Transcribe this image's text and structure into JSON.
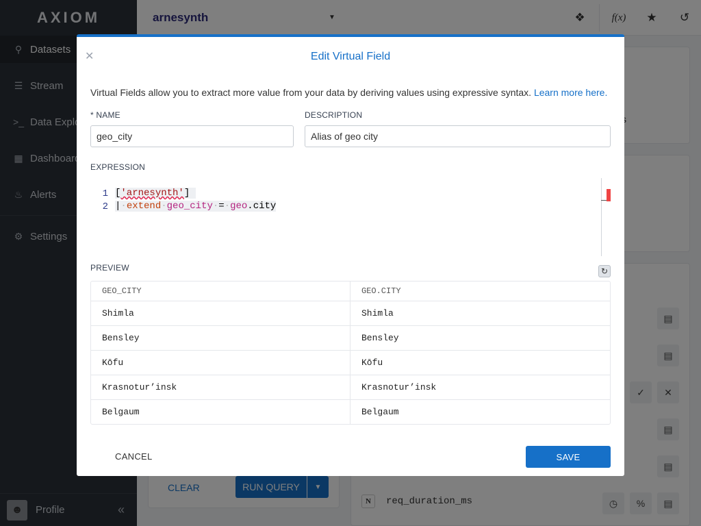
{
  "app": {
    "logo": "AXIOM"
  },
  "sidebar": {
    "items": [
      {
        "label": "Datasets",
        "icon": "search-icon"
      },
      {
        "label": "Stream",
        "icon": "stream-icon"
      },
      {
        "label": "Data Explorer",
        "icon": "terminal-icon"
      },
      {
        "label": "Dashboards",
        "icon": "dashboard-icon"
      },
      {
        "label": "Alerts",
        "icon": "bell-icon"
      },
      {
        "label": "Settings",
        "icon": "gear-icon"
      }
    ],
    "profile_label": "Profile"
  },
  "topbar": {
    "dataset": "arnesynth"
  },
  "background": {
    "clear_label": "CLEAR",
    "run_label": "RUN QUERY",
    "field_type": "N",
    "field_name": "req_duration_ms",
    "partial_text": "s"
  },
  "modal": {
    "title": "Edit Virtual Field",
    "description": "Virtual Fields allow you to extract more value from your data by deriving values using expressive syntax.",
    "learn_more": "Learn more here.",
    "name_label": "* NAME",
    "name_value": "geo_city",
    "description_label": "DESCRIPTION",
    "description_value": "Alias of geo city",
    "expression_label": "EXPRESSION",
    "code": {
      "line1_num": "1",
      "line2_num": "2",
      "line1_open": "[",
      "line1_str": "'arnesynth'",
      "line1_close": "]",
      "line2_pipe": "|",
      "line2_kw": "extend",
      "line2_field": "geo_city",
      "line2_eq": "=",
      "line2_ref": "geo",
      "line2_ref_tail": ".city"
    },
    "preview_label": "PREVIEW",
    "table": {
      "headers": [
        "GEO_CITY",
        "GEO.CITY"
      ],
      "rows": [
        [
          "Shimla",
          "Shimla"
        ],
        [
          "Bensley",
          "Bensley"
        ],
        [
          "Kōfu",
          "Kōfu"
        ],
        [
          "Krasnotur’insk",
          "Krasnotur’insk"
        ],
        [
          "Belgaum",
          "Belgaum"
        ]
      ]
    },
    "cancel_label": "CANCEL",
    "save_label": "SAVE"
  },
  "colors": {
    "accent": "#1670c8",
    "sidebar": "#2b3038",
    "dataset_title": "#2d2a7a"
  }
}
